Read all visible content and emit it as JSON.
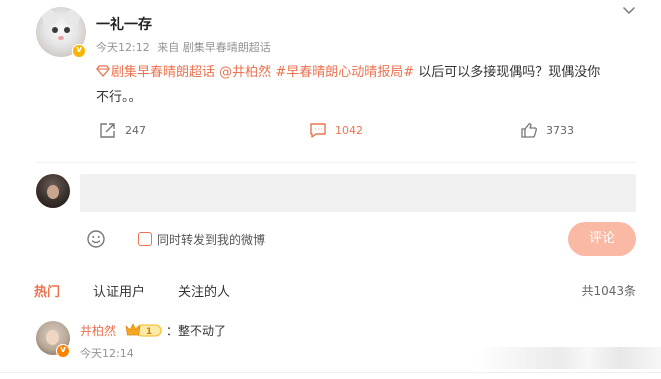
{
  "post": {
    "author_name": "一礼一存",
    "time": "今天12:12",
    "source": "来自 剧集早春晴朗超话",
    "topic_super": "剧集早春晴朗超话",
    "mention": "@井柏然",
    "hashtag": "#早春晴朗心动晴报局#",
    "text_line1": "以后可以多接现偶吗？现偶没你",
    "text_line2": "不行。。",
    "author_badge": "v"
  },
  "actions": {
    "repost_count": "247",
    "comment_count": "1042",
    "like_count": "3733"
  },
  "composer": {
    "input_value": "",
    "repost_option_label": "同时转发到我的微博",
    "submit_label": "评论"
  },
  "comments_header": {
    "tabs": [
      {
        "label": "热门",
        "active": true
      },
      {
        "label": "认证用户",
        "active": false
      },
      {
        "label": "关注的人",
        "active": false
      }
    ],
    "total": "共1043条"
  },
  "comments": [
    {
      "user": "井柏然",
      "text": "：整不动了",
      "time": "今天12:14",
      "vip_level": "1",
      "badge": "v"
    }
  ],
  "colors": {
    "accent": "#eb7350",
    "submit_disabled": "#f9b9a5",
    "verified_gold": "#f7b500"
  }
}
